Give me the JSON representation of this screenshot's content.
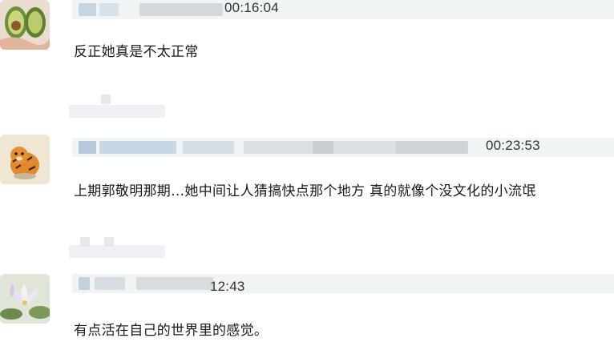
{
  "colors": {
    "meta_bar": "#f1f4f4",
    "text": "#1a1a1a",
    "time": "#333333"
  },
  "comments": [
    {
      "avatar_icon": "avocado-icon",
      "time": "00:16:04",
      "text": "反正她真是不太正常"
    },
    {
      "avatar_icon": "tiger-icon",
      "time": "00:23:53",
      "text": "上期郭敬明那期…她中间让人猜搞快点那个地方 真的就像个没文化的小流氓"
    },
    {
      "avatar_icon": "lotus-icon",
      "time": "12:43",
      "text": "有点活在自己的世界里的感觉。"
    }
  ]
}
